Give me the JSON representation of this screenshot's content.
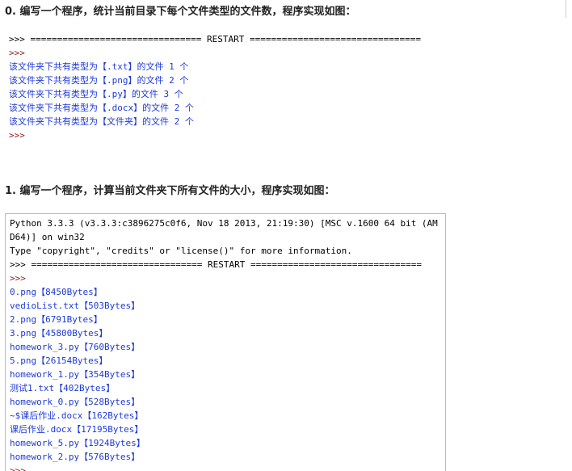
{
  "heading0": "0. 编写一个程序，统计当前目录下每个文件类型的文件数，程序实现如图：",
  "heading1": "1. 编写一个程序，计算当前文件夹下所有文件的大小，程序实现如图：",
  "shell1": {
    "restart": ">>> ================================ RESTART ================================",
    "prompt": ">>>",
    "lines": [
      "该文件夹下共有类型为【.txt】的文件 1 个",
      "该文件夹下共有类型为【.png】的文件 2 个",
      "该文件夹下共有类型为【.py】的文件 3 个",
      "该文件夹下共有类型为【.docx】的文件 2 个",
      "该文件夹下共有类型为【文件夹】的文件 2 个"
    ],
    "end_prompt": ">>>"
  },
  "shell2": {
    "banner1": "Python 3.3.3 (v3.3.3:c3896275c0f6, Nov 18 2013, 21:19:30) [MSC v.1600 64 bit (AM",
    "banner2": "D64)] on win32",
    "banner3": "Type \"copyright\", \"credits\" or \"license()\" for more information.",
    "restart": ">>> ================================ RESTART ================================",
    "prompt": ">>>",
    "files": [
      "0.png【8450Bytes】",
      "vedioList.txt【503Bytes】",
      "2.png【6791Bytes】",
      "3.png【45800Bytes】",
      "homework_3.py【760Bytes】",
      "5.png【26154Bytes】",
      "homework_1.py【354Bytes】",
      "测试1.txt【402Bytes】",
      "homework_0.py【528Bytes】",
      "~$课后作业.docx【162Bytes】",
      "课后作业.docx【17195Bytes】",
      "homework_5.py【1924Bytes】",
      "homework_2.py【576Bytes】"
    ],
    "end_prompt": ">>>"
  }
}
